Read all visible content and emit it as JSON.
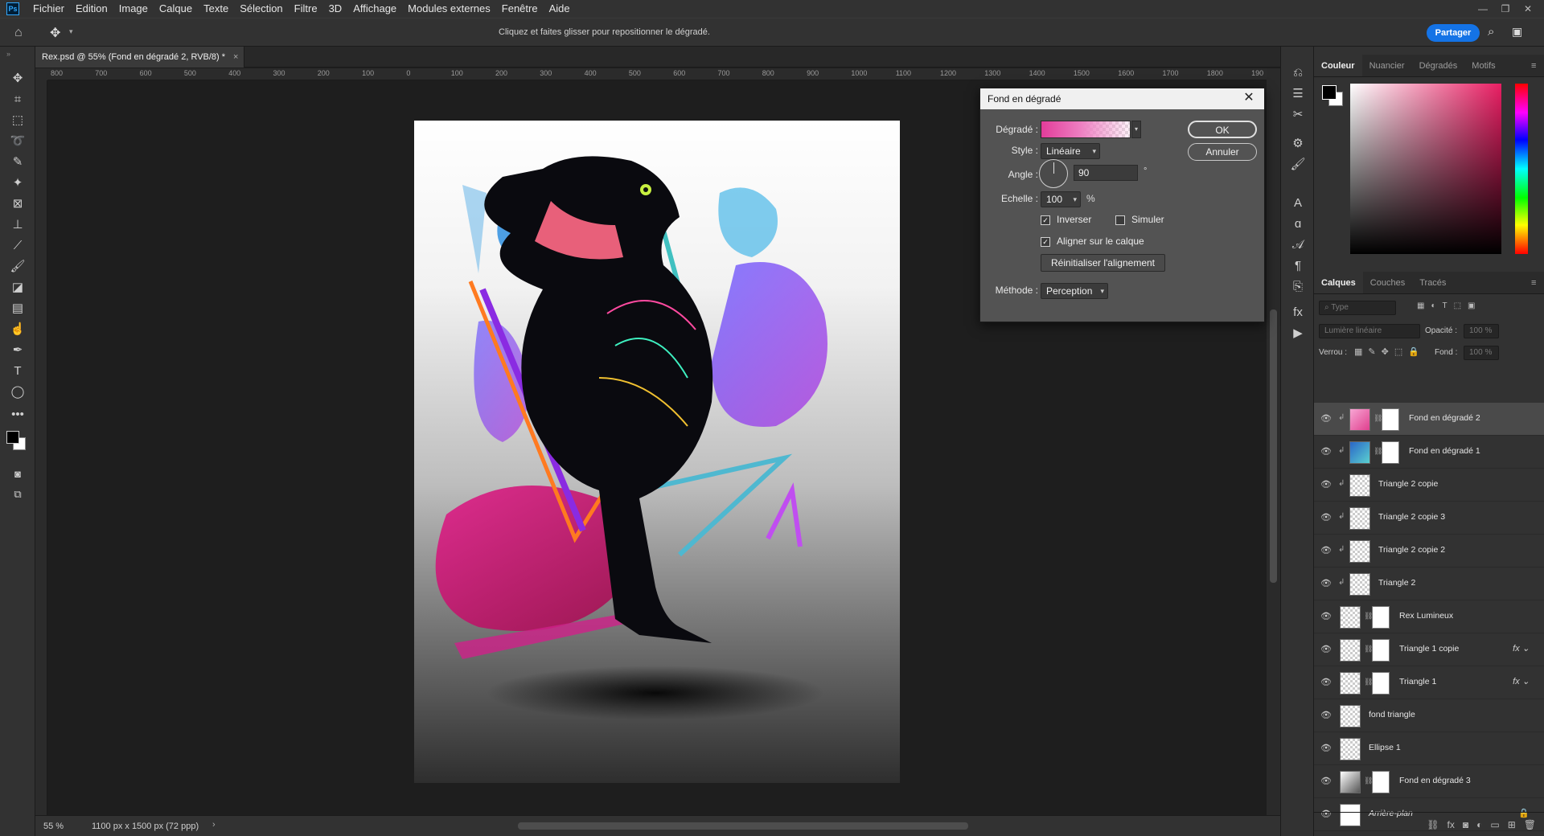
{
  "menubar": {
    "logo": "Ps",
    "items": [
      "Fichier",
      "Edition",
      "Image",
      "Calque",
      "Texte",
      "Sélection",
      "Filtre",
      "3D",
      "Affichage",
      "Modules externes",
      "Fenêtre",
      "Aide"
    ]
  },
  "options": {
    "hint": "Cliquez et faites glisser pour repositionner le dégradé.",
    "share_label": "Partager"
  },
  "document": {
    "tab_title": "Rex.psd @ 55% (Fond en dégradé 2, RVB/8) *",
    "close_glyph": "×"
  },
  "ruler": {
    "labels": [
      "800",
      "700",
      "600",
      "500",
      "400",
      "300",
      "200",
      "100",
      "0",
      "100",
      "200",
      "300",
      "400",
      "500",
      "600",
      "700",
      "800",
      "900",
      "1000",
      "1100",
      "1200",
      "1300",
      "1400",
      "1500",
      "1600",
      "1700",
      "1800",
      "190"
    ]
  },
  "status": {
    "zoom": "55 %",
    "doc_size": "1100 px x 1500 px (72 ppp)"
  },
  "color_panel": {
    "tabs": [
      "Couleur",
      "Nuancier",
      "Dégradés",
      "Motifs"
    ],
    "fg_color": "#000000",
    "bg_color": "#ffffff"
  },
  "layers_panel": {
    "tabs": [
      "Calques",
      "Couches",
      "Tracés"
    ],
    "filter_placeholder": "Type",
    "blend_mode": "Lumière linéaire",
    "opacity_label": "Opacité :",
    "opacity_value": "100 %",
    "lock_label": "Verrou :",
    "fill_label": "Fond :",
    "fill_value": "100 %",
    "layers": [
      {
        "name": "Fond en dégradé 2",
        "selected": true,
        "clipped": true,
        "has_mask": true
      },
      {
        "name": "Fond en dégradé 1",
        "selected": false,
        "clipped": true,
        "has_mask": true
      },
      {
        "name": "Triangle 2 copie",
        "selected": false,
        "clipped": true,
        "has_mask": false
      },
      {
        "name": "Triangle 2 copie 3",
        "selected": false,
        "clipped": true,
        "has_mask": false
      },
      {
        "name": "Triangle 2 copie 2",
        "selected": false,
        "clipped": true,
        "has_mask": false
      },
      {
        "name": "Triangle 2",
        "selected": false,
        "clipped": true,
        "has_mask": false
      },
      {
        "name": "Rex Lumineux",
        "selected": false,
        "clipped": false,
        "has_mask": true
      },
      {
        "name": "Triangle 1 copie",
        "selected": false,
        "clipped": false,
        "has_mask": true,
        "fx": true
      },
      {
        "name": "Triangle 1",
        "selected": false,
        "clipped": false,
        "has_mask": true,
        "fx": true
      },
      {
        "name": "fond triangle",
        "selected": false,
        "clipped": false,
        "has_mask": false
      },
      {
        "name": "Ellipse 1",
        "selected": false,
        "clipped": false,
        "has_mask": false
      },
      {
        "name": "Fond en dégradé 3",
        "selected": false,
        "clipped": false,
        "has_mask": true
      },
      {
        "name": "Arrière-plan",
        "selected": false,
        "clipped": false,
        "has_mask": false,
        "locked": true
      }
    ]
  },
  "dialog": {
    "title": "Fond en dégradé",
    "gradient_label": "Dégradé :",
    "style_label": "Style :",
    "style_value": "Linéaire",
    "angle_label": "Angle :",
    "angle_value": "90",
    "angle_unit": "°",
    "scale_label": "Echelle :",
    "scale_value": "100",
    "scale_unit": "%",
    "reverse_label": "Inverser",
    "reverse_checked": true,
    "dither_label": "Simuler",
    "dither_checked": false,
    "align_label": "Aligner sur le calque",
    "align_checked": true,
    "reset_label": "Réinitialiser l'alignement",
    "method_label": "Méthode :",
    "method_value": "Perception",
    "ok_label": "OK",
    "cancel_label": "Annuler"
  }
}
